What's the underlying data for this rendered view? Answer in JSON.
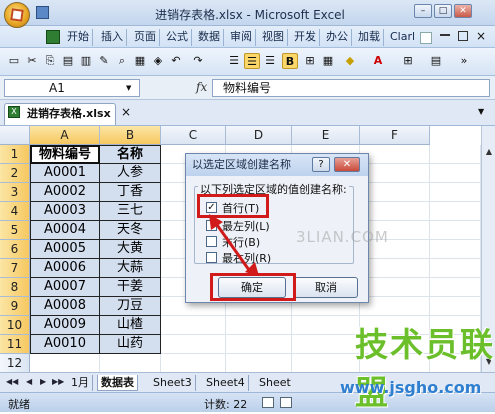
{
  "window": {
    "title": "进销存表格.xlsx - Microsoft Excel",
    "minimize_glyph": "–",
    "restore_glyph": "□",
    "close_glyph": "✕"
  },
  "menu": {
    "tabs": [
      "开始",
      "插入",
      "页面",
      "公式",
      "数据",
      "审阅",
      "视图",
      "开发",
      "办公",
      "加载",
      "Clarl"
    ]
  },
  "formula_bar": {
    "name_box": "A1",
    "fx": "fx",
    "formula": "物料编号"
  },
  "workbook_tab": {
    "label": "进销存表格.xlsx *",
    "close": "×"
  },
  "grid": {
    "columns": [
      "A",
      "B",
      "C",
      "D",
      "E",
      "F"
    ],
    "rows": [
      "1",
      "2",
      "3",
      "4",
      "5",
      "6",
      "7",
      "8",
      "9",
      "10",
      "11",
      "12"
    ],
    "header": [
      "物料编号",
      "名称"
    ],
    "data": [
      [
        "A0001",
        "人参"
      ],
      [
        "A0002",
        "丁香"
      ],
      [
        "A0003",
        "三七"
      ],
      [
        "A0004",
        "天冬"
      ],
      [
        "A0005",
        "大黄"
      ],
      [
        "A0006",
        "大蒜"
      ],
      [
        "A0007",
        "干姜"
      ],
      [
        "A0008",
        "刀豆"
      ],
      [
        "A0009",
        "山楂"
      ],
      [
        "A0010",
        "山药"
      ]
    ]
  },
  "sheet_tabs": {
    "tabs": [
      "1月",
      "数据表",
      "Sheet3",
      "Sheet4",
      "Sheet"
    ],
    "active": "数据表"
  },
  "status": {
    "mode": "就绪",
    "count": "计数: 22"
  },
  "dialog": {
    "title": "以选定区域创建名称",
    "help": "?",
    "close": "✕",
    "group_label": "以下列选定区域的值创建名称:",
    "options": [
      {
        "label": "首行(T)",
        "checked": true
      },
      {
        "label": "最左列(L)",
        "checked": false
      },
      {
        "label": "末行(B)",
        "checked": false
      },
      {
        "label": "最右列(R)",
        "checked": false
      }
    ],
    "ok": "确定",
    "cancel": "取消"
  },
  "watermarks": {
    "site_cn": "技术员联盟",
    "site_url": "www.jsgho.com",
    "faint": "3LIAN.COM"
  },
  "colors": {
    "highlight_red": "#d11a1a",
    "selection_fill": "#d3deef",
    "header_selected": "#f6c860"
  }
}
